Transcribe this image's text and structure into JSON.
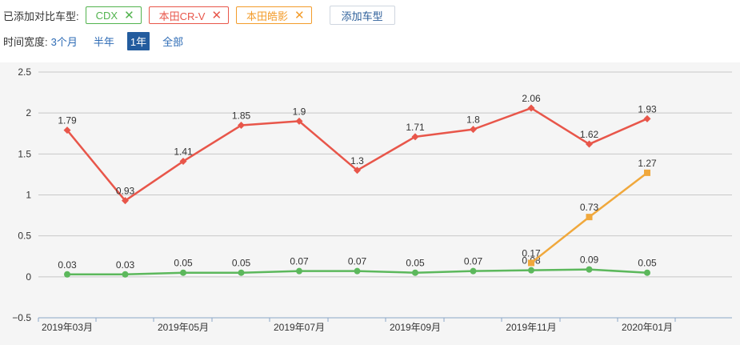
{
  "header": {
    "compare_label": "已添加对比车型:",
    "chips": [
      {
        "name": "CDX",
        "color": "#52b34e"
      },
      {
        "name": "本田CR-V",
        "color": "#e8564a"
      },
      {
        "name": "本田皓影",
        "color": "#f39c2b"
      }
    ],
    "remove_glyph": "✕",
    "add_button": "添加车型"
  },
  "range": {
    "label": "时间宽度:",
    "options": [
      "3个月",
      "半年",
      "1年",
      "全部"
    ],
    "active": "1年"
  },
  "chart_data": {
    "type": "line",
    "x": [
      "2019年03月",
      "2019年04月",
      "2019年05月",
      "2019年06月",
      "2019年07月",
      "2019年08月",
      "2019年09月",
      "2019年10月",
      "2019年11月",
      "2019年12月",
      "2020年01月"
    ],
    "x_tick_labels": [
      "2019年03月",
      "2019年05月",
      "2019年07月",
      "2019年09月",
      "2019年11月",
      "2020年01月"
    ],
    "ylim": [
      -0.5,
      2.5
    ],
    "yticks": [
      -0.5,
      0,
      0.5,
      1,
      1.5,
      2,
      2.5
    ],
    "grid": true,
    "series": [
      {
        "name": "本田CR-V",
        "color": "#e8564a",
        "marker": "diamond",
        "values": [
          1.79,
          0.93,
          1.41,
          1.85,
          1.9,
          1.3,
          1.71,
          1.8,
          2.06,
          1.62,
          1.93
        ]
      },
      {
        "name": "CDX",
        "color": "#5cb85c",
        "marker": "circle",
        "values": [
          0.03,
          0.03,
          0.05,
          0.05,
          0.07,
          0.07,
          0.05,
          0.07,
          0.08,
          0.09,
          0.05
        ]
      },
      {
        "name": "本田皓影",
        "color": "#f0a83c",
        "marker": "square",
        "values": [
          null,
          null,
          null,
          null,
          null,
          null,
          null,
          null,
          0.17,
          0.73,
          1.27
        ]
      }
    ]
  }
}
